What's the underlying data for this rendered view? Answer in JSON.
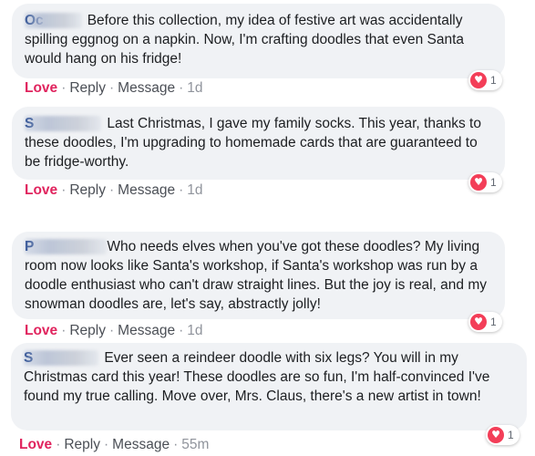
{
  "comments": [
    {
      "author": "Oc",
      "text": "Before this collection, my idea of festive art was accidentally spilling eggnog on a napkin. Now, I'm crafting doodles that even Santa would hang on his fridge!",
      "love_label": "Love",
      "reply_label": "Reply",
      "message_label": "Message",
      "time": "1d",
      "reaction_count": "1"
    },
    {
      "author": "S",
      "text": "Last Christmas, I gave my family socks. This year, thanks to these doodles, I'm upgrading to homemade cards that are guaranteed to be fridge-worthy.",
      "love_label": "Love",
      "reply_label": "Reply",
      "message_label": "Message",
      "time": "1d",
      "reaction_count": "1"
    },
    {
      "author": "P",
      "text": "Who needs elves when you've got these doodles? My living room now looks like Santa's workshop, if Santa's workshop was run by a doodle enthusiast who can't draw straight lines. But the joy is real, and my snowman doodles are, let's say, abstractly jolly!",
      "love_label": "Love",
      "reply_label": "Reply",
      "message_label": "Message",
      "time": "1d",
      "reaction_count": "1"
    },
    {
      "author": "S",
      "text": "Ever seen a reindeer doodle with six legs? You will in my Christmas card this year! These doodles are so fun, I'm half-convinced I've found my true calling. Move over, Mrs. Claus, there's a new artist in town!",
      "love_label": "Love",
      "reply_label": "Reply",
      "message_label": "Message",
      "time": "55m",
      "reaction_count": "1"
    }
  ],
  "colors": {
    "bubble": "#f0f2f5",
    "author": "#385898",
    "love": "#e0245e",
    "heart": "#f33e58"
  },
  "icons": {
    "reaction": "heart-icon"
  }
}
